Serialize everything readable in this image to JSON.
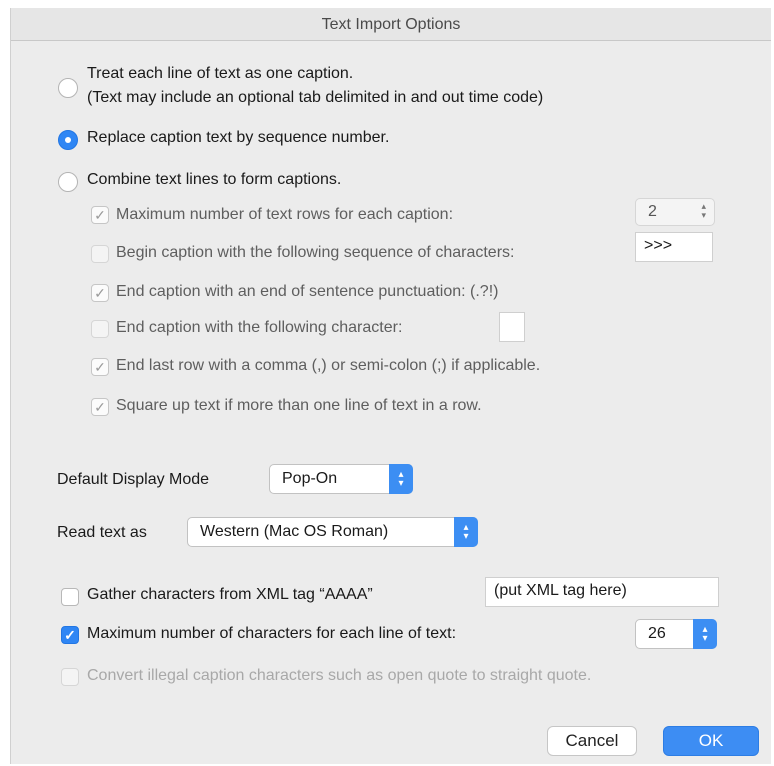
{
  "window": {
    "title": "Text Import Options"
  },
  "radios": [
    {
      "label": "Treat each line of text as one caption.",
      "sub": "(Text may include an optional tab delimited in and out time code)",
      "selected": false
    },
    {
      "label": "Replace caption text by sequence number.",
      "selected": true
    },
    {
      "label": "Combine text lines to form captions.",
      "selected": false
    }
  ],
  "combine_options": {
    "max_rows": {
      "label": "Maximum number of text rows for each caption:",
      "checked": true,
      "value": "2"
    },
    "begin_seq": {
      "label": "Begin caption with the following sequence of characters:",
      "checked": false,
      "value": ">>>"
    },
    "end_punct": {
      "label": "End caption with an end of sentence punctuation:  (.?!)",
      "checked": true
    },
    "end_char": {
      "label": "End caption with the following character:",
      "checked": false,
      "value": ""
    },
    "end_last_row": {
      "label": "End last row with a comma (,) or semi-colon (;) if applicable.",
      "checked": true
    },
    "square_up": {
      "label": "Square up text if more than one line of text in a row.",
      "checked": true
    }
  },
  "display_mode": {
    "label": "Default Display Mode",
    "value": "Pop-On"
  },
  "read_text": {
    "label": "Read text as",
    "value": "Western (Mac OS Roman)"
  },
  "xml_gather": {
    "label": "Gather characters from XML tag “AAAA”",
    "checked": false,
    "value": "(put XML tag here)"
  },
  "max_chars": {
    "label": "Maximum number of characters for each line of text:",
    "checked": true,
    "value": "26"
  },
  "convert_illegal": {
    "label": "Convert illegal caption characters such as open quote to straight quote.",
    "checked": false
  },
  "buttons": {
    "cancel": "Cancel",
    "ok": "OK"
  },
  "icons": {
    "check": "✓",
    "up": "▴",
    "down": "▾"
  },
  "colors": {
    "accent": "#2f86f4"
  }
}
